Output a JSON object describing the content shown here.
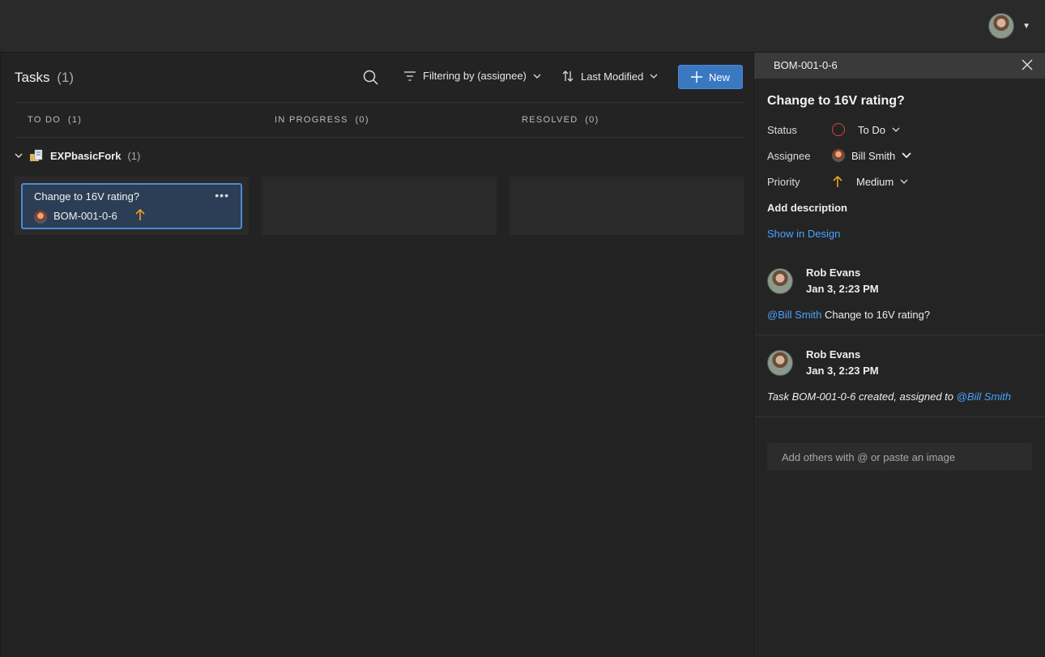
{
  "tasks": {
    "title": "Tasks",
    "count": "(1)"
  },
  "toolbar": {
    "filter_label": "Filtering by (assignee)",
    "sort_label": "Last Modified",
    "new_label": "New"
  },
  "columns": [
    {
      "label": "TO DO",
      "count": "(1)"
    },
    {
      "label": "IN PROGRESS",
      "count": "(0)"
    },
    {
      "label": "RESOLVED",
      "count": "(0)"
    }
  ],
  "group": {
    "name": "EXPbasicFork",
    "count": "(1)"
  },
  "card": {
    "title": "Change to 16V rating?",
    "id": "BOM-001-0-6",
    "more": "•••"
  },
  "panel": {
    "id": "BOM-001-0-6",
    "title": "Change to 16V rating?",
    "status_label": "Status",
    "status_value": "To Do",
    "assignee_label": "Assignee",
    "assignee_value": "Bill Smith",
    "priority_label": "Priority",
    "priority_value": "Medium",
    "add_description": "Add description",
    "show_in_design": "Show in Design",
    "comments": [
      {
        "author": "Rob Evans",
        "time": "Jan 3, 2:23 PM",
        "mention": "@Bill Smith",
        "text": " Change to 16V rating?"
      },
      {
        "author": "Rob Evans",
        "time": "Jan 3, 2:23 PM",
        "text": "Task BOM-001-0-6 created, assigned to ",
        "mention": "@Bill Smith"
      }
    ],
    "comment_placeholder": "Add others with @ or paste an image"
  },
  "colors": {
    "accent": "#3a78c2",
    "link": "#4aa3ff",
    "status_todo": "#e0443a",
    "priority_medium": "#f0a020"
  }
}
